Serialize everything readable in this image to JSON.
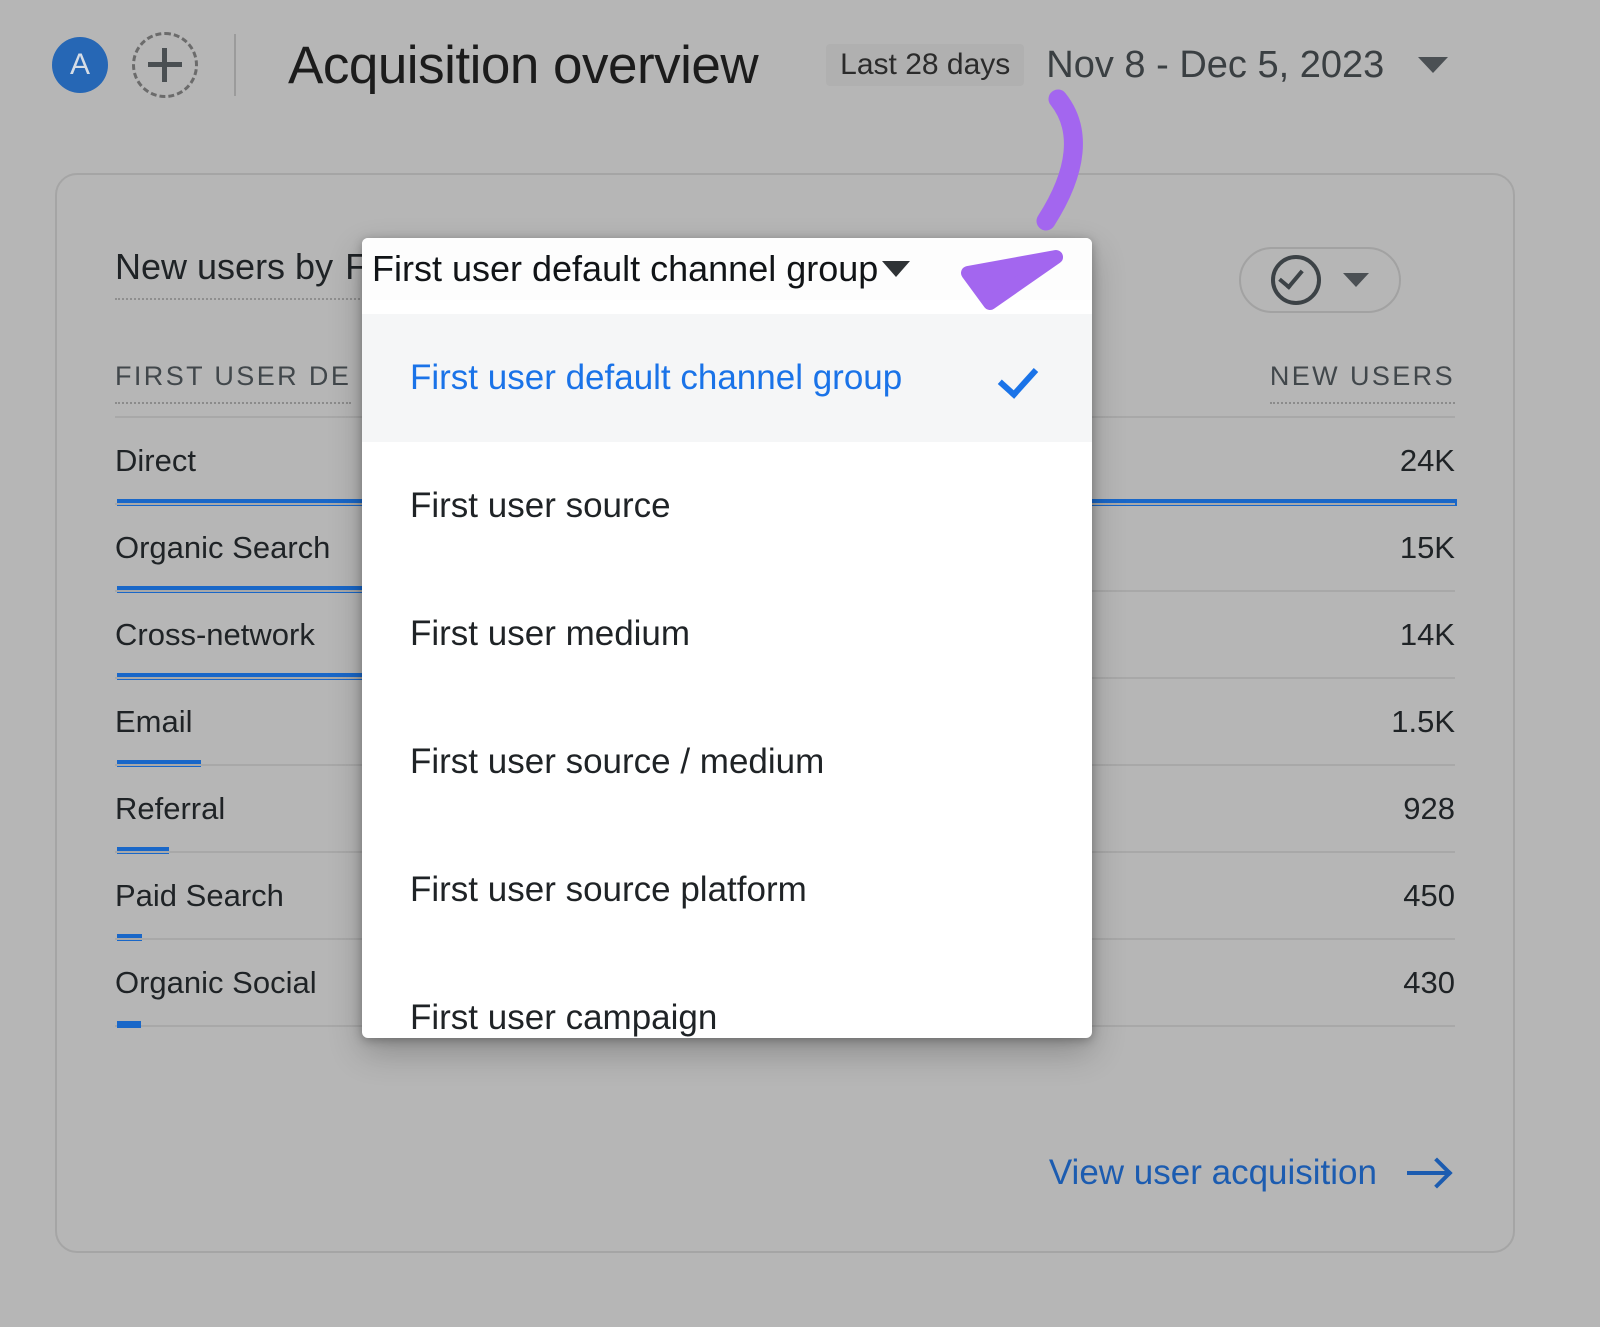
{
  "topbar": {
    "avatar_initial": "A",
    "add_icon": "plus-circle-icon",
    "title": "Acquisition overview",
    "date_preset": "Last 28 days",
    "date_range": "Nov 8 - Dec 5, 2023",
    "caret_icon": "chevron-down-icon"
  },
  "card": {
    "title_prefix": "New users by",
    "title_dimension": "First user default channel group",
    "header_action": {
      "icon": "check-circle-icon",
      "caret_icon": "chevron-down-icon"
    },
    "footer_link": "View user acquisition",
    "footer_arrow_icon": "arrow-right-icon"
  },
  "table": {
    "columns": [
      "FIRST USER DEFAULT CHANNEL GROUP",
      "NEW USERS"
    ],
    "column_labels_visible": [
      "FIRST USER DE",
      "NEW USERS"
    ],
    "rows": [
      {
        "label": "Direct",
        "value": "24K",
        "bar_pct": 100
      },
      {
        "label": "Organic Search",
        "value": "15K",
        "bar_pct": 63
      },
      {
        "label": "Cross-network",
        "value": "14K",
        "bar_pct": 58
      },
      {
        "label": "Email",
        "value": "1.5K",
        "bar_pct": 6.3
      },
      {
        "label": "Referral",
        "value": "928",
        "bar_pct": 3.9
      },
      {
        "label": "Paid Search",
        "value": "450",
        "bar_pct": 1.9
      },
      {
        "label": "Organic Social",
        "value": "430",
        "bar_pct": 1.8
      }
    ],
    "bar_color": "#1967c8"
  },
  "dropdown": {
    "current_label": "First user default channel group",
    "current_caret_icon": "chevron-down-icon",
    "items": [
      {
        "label": "First user default channel group",
        "selected": true
      },
      {
        "label": "First user source",
        "selected": false
      },
      {
        "label": "First user medium",
        "selected": false
      },
      {
        "label": "First user source / medium",
        "selected": false
      },
      {
        "label": "First user source platform",
        "selected": false
      },
      {
        "label": "First user campaign",
        "selected": false
      }
    ],
    "selected_color": "#1a73e8",
    "check_icon": "checkmark-icon"
  },
  "annotation": {
    "shape": "curved-arrow",
    "color": "#a663f0",
    "points_to": "dropdown-caret"
  },
  "colors": {
    "page_background": "#b6b6b6",
    "accent_blue": "#1a73e8",
    "link_blue": "#1c5cb0",
    "avatar_blue": "#2667b5"
  }
}
